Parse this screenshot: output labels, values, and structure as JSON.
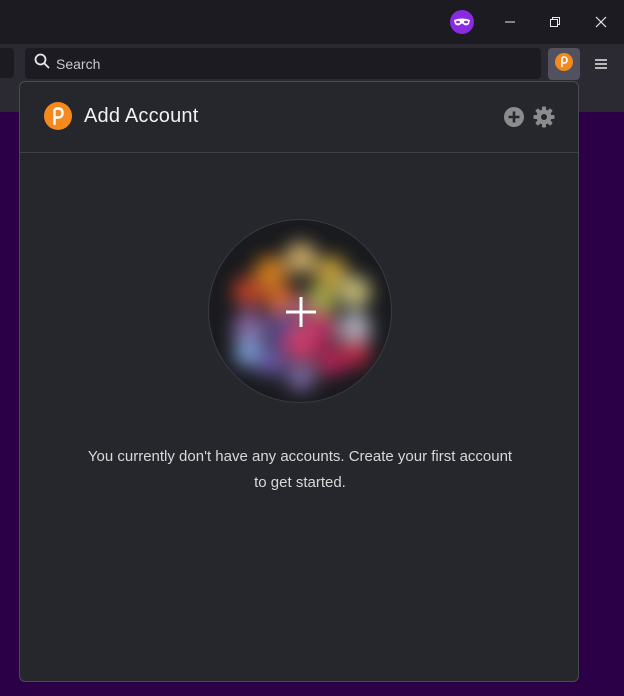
{
  "browser": {
    "search_placeholder": "Search"
  },
  "icons": {
    "private": "private-browsing-mask-icon",
    "search": "search-icon",
    "extension": "polkadot-extension-icon",
    "menu": "hamburger-menu-icon",
    "minimize": "minimize-icon",
    "restore": "restore-icon",
    "close": "close-icon",
    "add": "add-circle-icon",
    "settings": "gear-icon",
    "avatar_plus": "plus-icon"
  },
  "popup": {
    "title": "Add Account",
    "empty_message": "You currently don't have any accounts. Create your first account to get started."
  },
  "colors": {
    "brand": "#f5891e",
    "private": "#8a2be2",
    "popup_bg": "#26272c",
    "page_bg": "#2b0046"
  }
}
